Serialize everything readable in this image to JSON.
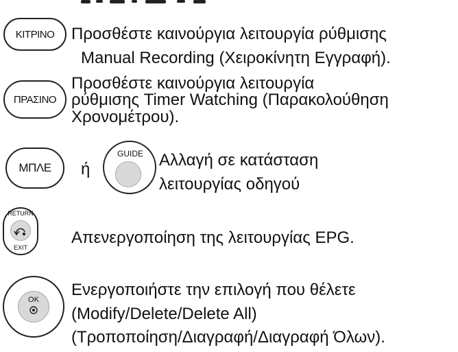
{
  "rows": [
    {
      "button": {
        "label": "ΚΙΤΡΙΝΟ"
      },
      "lines": [
        "Προσθέστε καινούργια λειτουργία ρύθμισης",
        "Manual Recording (Χειροκίνητη Εγγραφή)."
      ]
    },
    {
      "button": {
        "label": "ΠΡΑΣΙΝΟ"
      },
      "lines": [
        "Προσθέστε καινούργια λειτουργία",
        "ρύθμισης Timer Watching (Παρακολούθηση",
        "Χρονομέτρου)."
      ]
    },
    {
      "button": {
        "label": "ΜΠΛΕ"
      },
      "or_text": "ή",
      "guide_label": "GUIDE",
      "lines": [
        "Αλλαγή σε κατάσταση",
        "λειτουργίας οδηγού"
      ]
    },
    {
      "button": {
        "top_label": "RETURN",
        "bottom_label": "EXIT"
      },
      "lines": [
        "Απενεργοποίηση της λειτουργίας EPG."
      ]
    },
    {
      "button": {
        "label": "OK"
      },
      "lines": [
        "Ενεργοποιήστε την επιλογή που θέλετε",
        "(Modify/Delete/Delete All)",
        "(Τροποποίηση/Διαγραφή/Διαγραφή Όλων)."
      ]
    }
  ]
}
